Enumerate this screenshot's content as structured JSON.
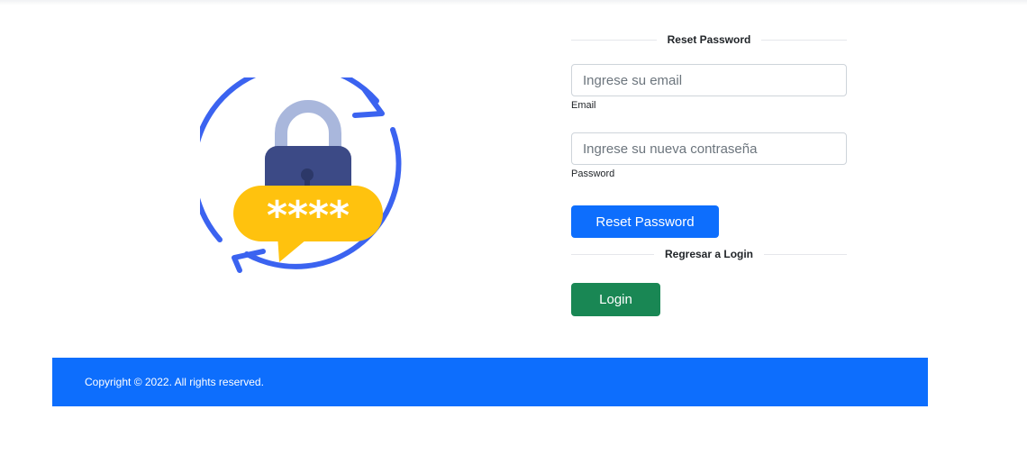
{
  "reset_section": {
    "heading": "Reset Password",
    "email_placeholder": "Ingrese su email",
    "email_label": "Email",
    "password_placeholder": "Ingrese su nueva contraseña",
    "password_label": "Password",
    "submit_label": "Reset Password"
  },
  "login_section": {
    "heading": "Regresar a Login",
    "login_label": "Login"
  },
  "illustration": {
    "masked_text": "****",
    "icon": "lock-reset-icon"
  },
  "footer": {
    "copyright": "Copyright © 2022. All rights reserved."
  },
  "colors": {
    "primary": "#0d6efd",
    "success": "#198754",
    "ring": "#3b63f0",
    "lock_body": "#3c4a86",
    "lock_shackle": "#a9b7dc",
    "bubble": "#ffc20e"
  }
}
